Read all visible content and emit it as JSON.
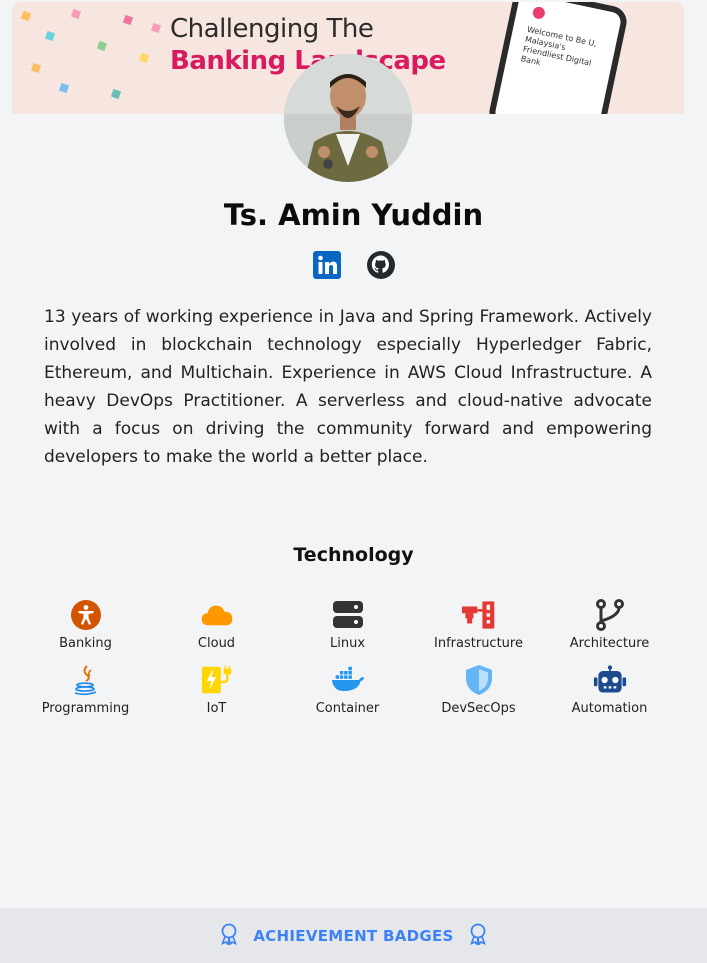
{
  "banner": {
    "line1": "Challenging The",
    "line2": "Banking Landscape",
    "phone_text": "Welcome to Be U, Malaysia's Friendliest Digital Bank"
  },
  "profile": {
    "name": "Ts. Amin Yuddin",
    "social": [
      {
        "name": "linkedin-icon",
        "color": "#0a66c2"
      },
      {
        "name": "github-icon",
        "color": "#24292f"
      }
    ],
    "bio": "13 years of working experience in Java and Spring Framework. Actively involved in blockchain technology especially Hyperledger Fabric, Ethereum, and Multichain. Experience in AWS Cloud Infrastructure. A heavy DevOps Practitioner. A serverless and cloud-native advocate with a focus on driving the community forward and empowering developers to make the world a better place."
  },
  "technology": {
    "title": "Technology",
    "items": [
      {
        "label": "Banking",
        "icon": "accessibility-icon",
        "color": "#d35400"
      },
      {
        "label": "Cloud",
        "icon": "cloud-icon",
        "color": "#ff9800"
      },
      {
        "label": "Linux",
        "icon": "server-icon",
        "color": "#333333"
      },
      {
        "label": "Infrastructure",
        "icon": "network-icon",
        "color": "#e53935"
      },
      {
        "label": "Architecture",
        "icon": "git-branch-icon",
        "color": "#333333"
      },
      {
        "label": "Programming",
        "icon": "java-icon",
        "color": "#1e88e5"
      },
      {
        "label": "IoT",
        "icon": "iot-icon",
        "color": "#ffd600"
      },
      {
        "label": "Container",
        "icon": "docker-icon",
        "color": "#2496ed"
      },
      {
        "label": "DevSecOps",
        "icon": "shield-icon",
        "color": "#64b5f6"
      },
      {
        "label": "Automation",
        "icon": "robot-icon",
        "color": "#1e4b8f"
      }
    ]
  },
  "footer": {
    "label": "ACHIEVEMENT BADGES",
    "accent": "#3b82f6"
  }
}
